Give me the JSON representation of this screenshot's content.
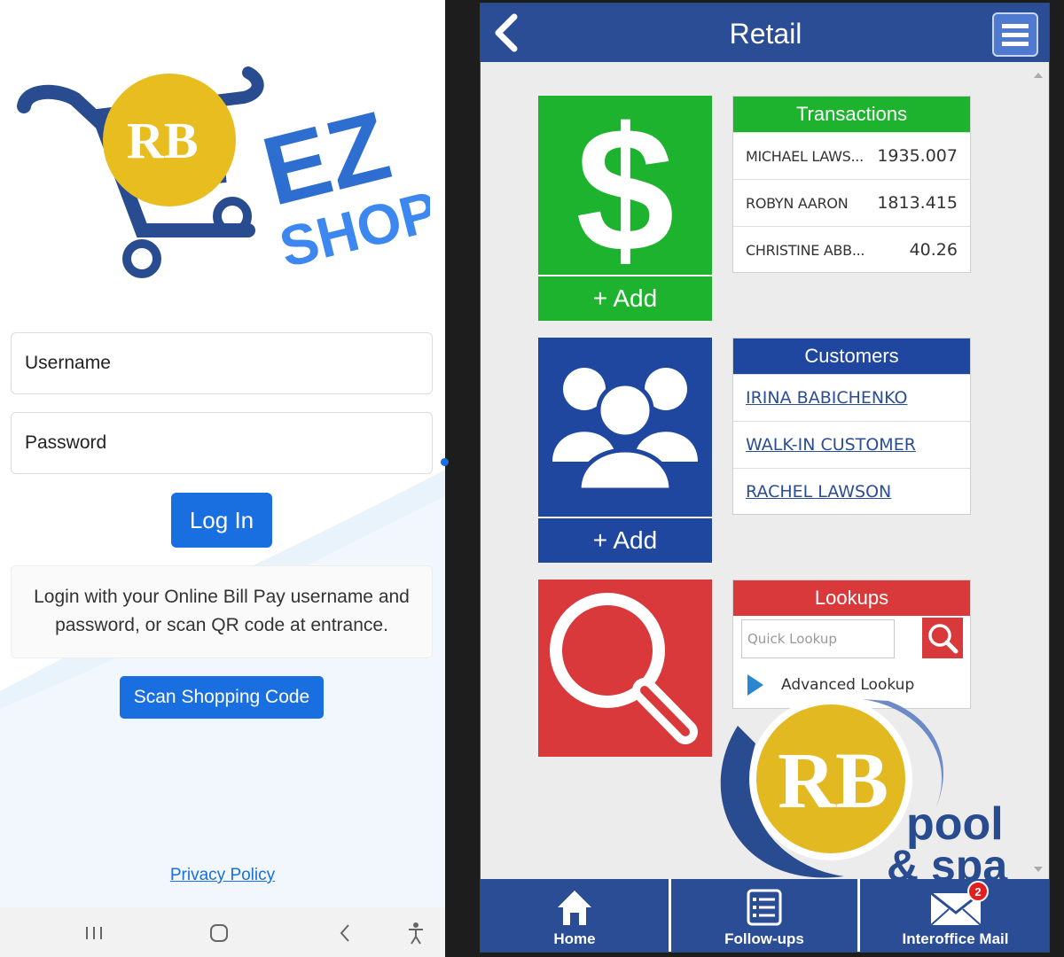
{
  "login": {
    "logo_initials": "RB",
    "logo_ez": "EZ",
    "logo_shop": "SHOP",
    "username_placeholder": "Username",
    "password_placeholder": "Password",
    "login_button": "Log In",
    "info_line1": "Login with your Online Bill Pay username and",
    "info_line2": "password, or scan QR code at entrance.",
    "scan_button": "Scan Shopping Code",
    "privacy_link": "Privacy Policy",
    "nav_icons": [
      "recent-apps-icon",
      "home-icon",
      "back-icon",
      "accessibility-icon"
    ]
  },
  "app": {
    "title": "Retail",
    "tiles": {
      "transactions_add": "+ Add",
      "customers_add": "+ Add"
    },
    "transactions": {
      "header": "Transactions",
      "rows": [
        {
          "name": "MICHAEL LAWS...",
          "amount": "1935.007"
        },
        {
          "name": "ROBYN AARON",
          "amount": "1813.415"
        },
        {
          "name": "CHRISTINE ABB...",
          "amount": "40.26"
        }
      ]
    },
    "customers": {
      "header": "Customers",
      "rows": [
        "IRINA BABICHENKO",
        "WALK-IN CUSTOMER",
        "RACHEL LAWSON"
      ]
    },
    "lookups": {
      "header": "Lookups",
      "quick_placeholder": "Quick Lookup",
      "advanced": "Advanced Lookup"
    },
    "watermark": {
      "initials": "RB",
      "line1": "pool",
      "line2": "& spa"
    },
    "bottom_nav": {
      "home": "Home",
      "followups": "Follow-ups",
      "mail": "Interoffice Mail",
      "mail_badge": "2"
    },
    "colors": {
      "header": "#2b4d96",
      "green": "#1db32e",
      "blue": "#1f47a0",
      "red": "#d9393a"
    }
  }
}
